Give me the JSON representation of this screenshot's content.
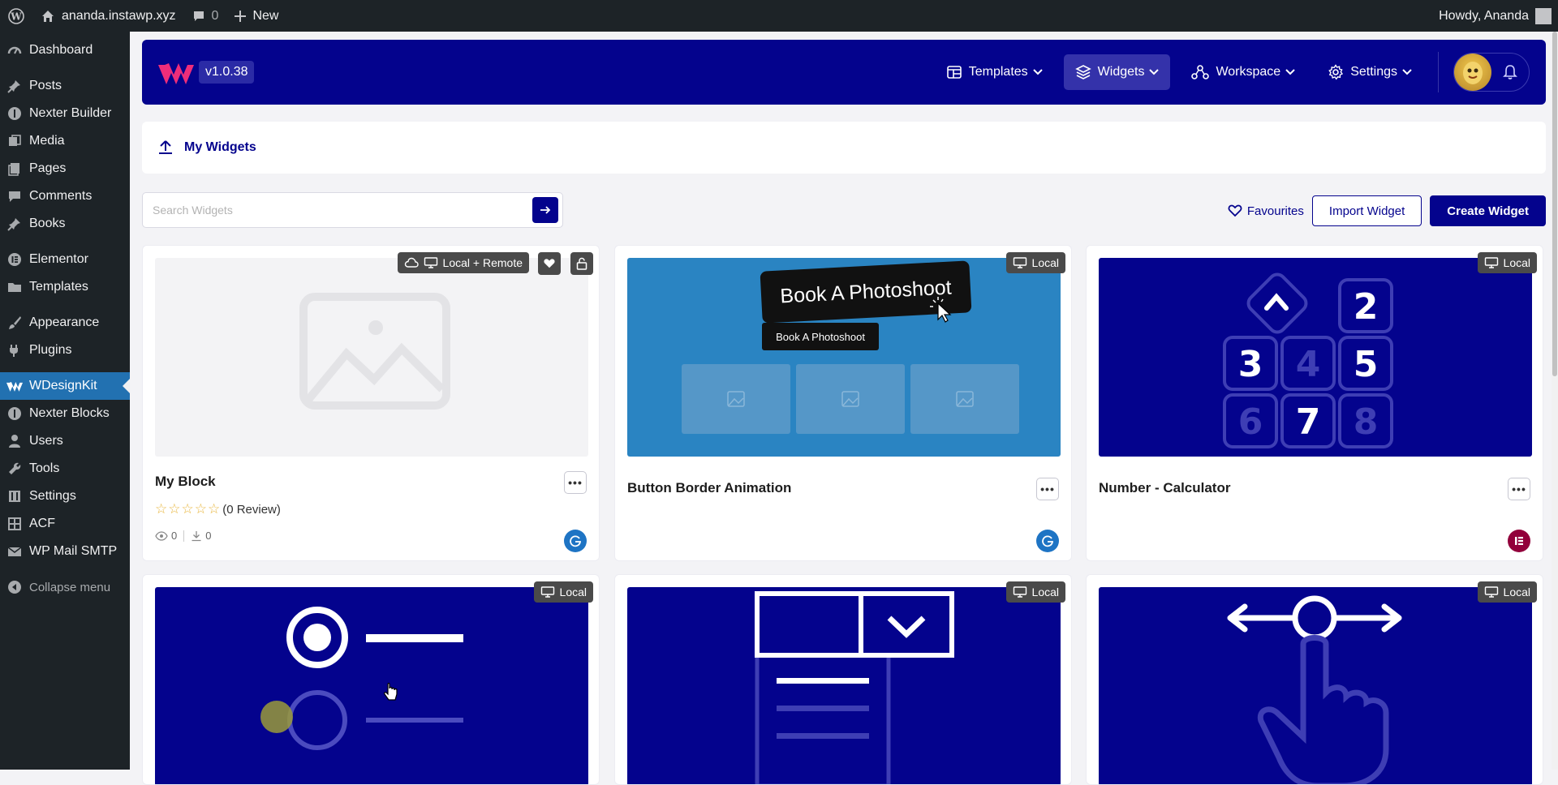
{
  "adminbar": {
    "site": "ananda.instawp.xyz",
    "comments": "0",
    "new": "New",
    "howdy": "Howdy, Ananda"
  },
  "sidebar": {
    "items": [
      {
        "label": "Dashboard",
        "icon": "dashboard-icon"
      },
      {
        "label": "Posts",
        "icon": "pin-icon"
      },
      {
        "label": "Nexter Builder",
        "icon": "nexter-icon"
      },
      {
        "label": "Media",
        "icon": "media-icon"
      },
      {
        "label": "Pages",
        "icon": "pages-icon"
      },
      {
        "label": "Comments",
        "icon": "comment-icon"
      },
      {
        "label": "Books",
        "icon": "pin-icon"
      },
      {
        "label": "Elementor",
        "icon": "elementor-icon"
      },
      {
        "label": "Templates",
        "icon": "folder-icon"
      },
      {
        "label": "Appearance",
        "icon": "brush-icon"
      },
      {
        "label": "Plugins",
        "icon": "plug-icon"
      },
      {
        "label": "WDesignKit",
        "icon": "wdesignkit-icon",
        "active": true
      },
      {
        "label": "Nexter Blocks",
        "icon": "nexter-icon"
      },
      {
        "label": "Users",
        "icon": "user-icon"
      },
      {
        "label": "Tools",
        "icon": "wrench-icon"
      },
      {
        "label": "Settings",
        "icon": "sliders-icon"
      },
      {
        "label": "ACF",
        "icon": "grid-icon"
      },
      {
        "label": "WP Mail SMTP",
        "icon": "mail-icon"
      }
    ],
    "collapse": "Collapse menu"
  },
  "header": {
    "version": "v1.0.38",
    "nav": [
      {
        "label": "Templates",
        "icon": "templates-icon"
      },
      {
        "label": "Widgets",
        "icon": "widgets-icon",
        "active": true
      },
      {
        "label": "Workspace",
        "icon": "workspace-icon"
      },
      {
        "label": "Settings",
        "icon": "gear-icon"
      }
    ]
  },
  "breadcrumb": {
    "title": "My Widgets"
  },
  "search": {
    "placeholder": "Search Widgets",
    "value": ""
  },
  "actions": {
    "favourites": "Favourites",
    "import": "Import Widget",
    "create": "Create Widget"
  },
  "cards": [
    {
      "title": "My Block",
      "tag": "Local + Remote",
      "rating_text": "(0 Review)",
      "views": "0",
      "downloads": "0",
      "builder": "gutenberg"
    },
    {
      "title": "Button Border Animation",
      "tag": "Local",
      "thumb_text_big": "Book A Photoshoot",
      "thumb_text_small": "Book A Photoshoot",
      "builder": "gutenberg"
    },
    {
      "title": "Number - Calculator",
      "tag": "Local",
      "builder": "elementor",
      "digits": [
        "2",
        "3",
        "4",
        "5",
        "6",
        "7",
        "8"
      ]
    },
    {
      "tag": "Local"
    },
    {
      "tag": "Local"
    },
    {
      "tag": "Local"
    }
  ],
  "colors": {
    "brand": "#04038d",
    "wp_active": "#2271b1",
    "gutenberg": "#1e74c4",
    "elementor": "#92003b"
  }
}
